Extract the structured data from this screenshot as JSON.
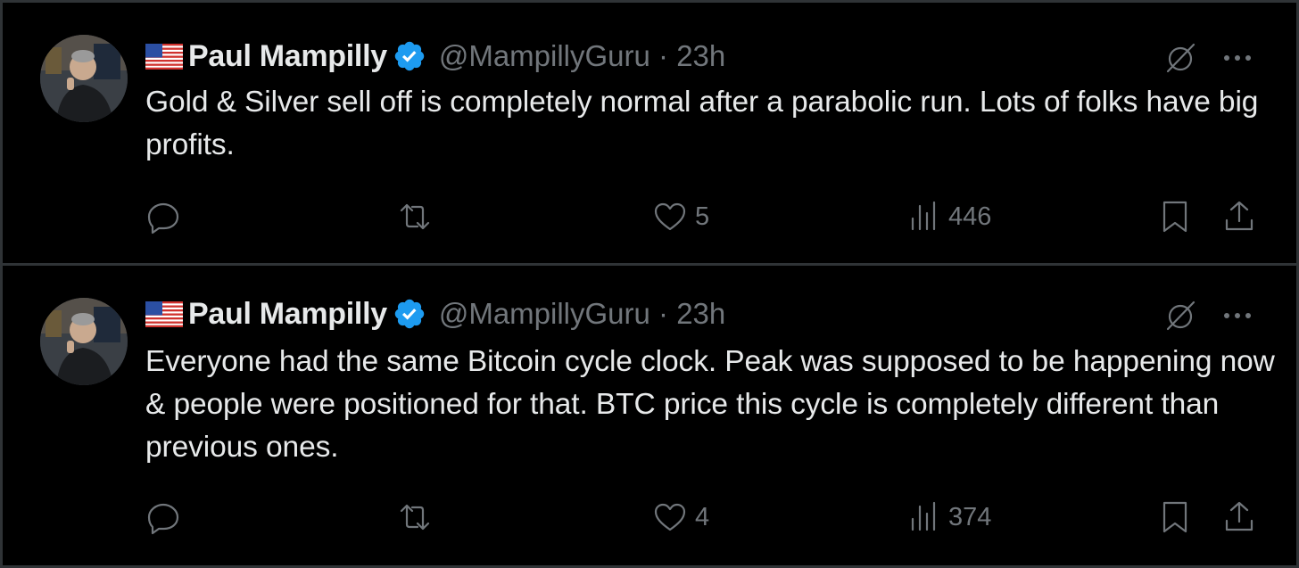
{
  "colors": {
    "background": "#000000",
    "divider": "#2f3336",
    "primary_text": "#e7e9ea",
    "secondary_text": "#71767b",
    "verified_blue": "#1d9bf0"
  },
  "tweets": [
    {
      "author_name": "Paul Mampilly",
      "handle_time": "@MampillyGuru · 23h",
      "text": "Gold & Silver sell off is completely normal after a parabolic run. Lots of folks have big profits.",
      "reply_count": "",
      "retweet_count": "",
      "like_count": "5",
      "view_count": "446",
      "icons": [
        "avatar",
        "us-flag-icon",
        "verified-badge-icon",
        "grok-icon",
        "more-icon",
        "reply-icon",
        "retweet-icon",
        "like-icon",
        "views-icon",
        "bookmark-icon",
        "share-icon"
      ]
    },
    {
      "author_name": "Paul Mampilly",
      "handle_time": "@MampillyGuru · 23h",
      "text": "Everyone had the same Bitcoin cycle clock. Peak was supposed to be happening now & people were positioned for that. BTC price this cycle is completely different than previous ones.",
      "reply_count": "",
      "retweet_count": "",
      "like_count": "4",
      "view_count": "374",
      "icons": [
        "avatar",
        "us-flag-icon",
        "verified-badge-icon",
        "grok-icon",
        "more-icon",
        "reply-icon",
        "retweet-icon",
        "like-icon",
        "views-icon",
        "bookmark-icon",
        "share-icon"
      ]
    }
  ]
}
